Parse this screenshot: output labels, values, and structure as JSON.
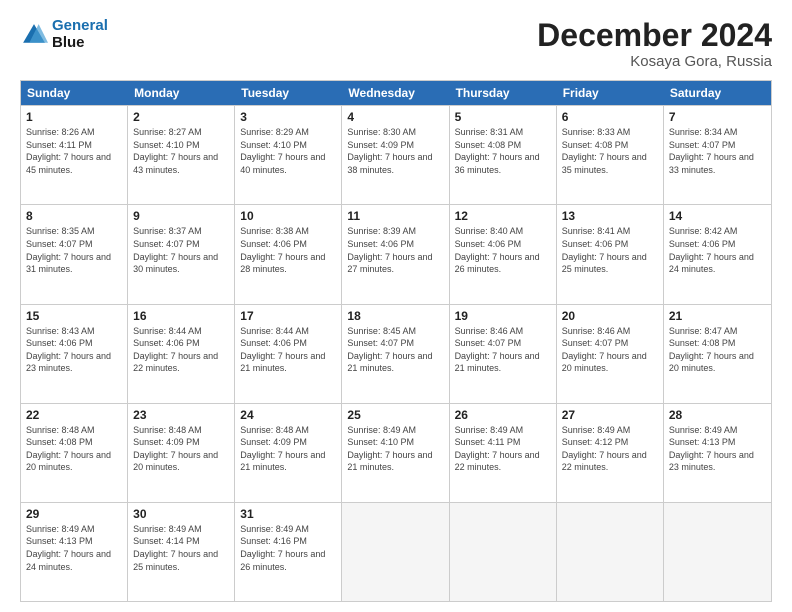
{
  "header": {
    "logo_line1": "General",
    "logo_line2": "Blue",
    "title": "December 2024",
    "subtitle": "Kosaya Gora, Russia"
  },
  "days_of_week": [
    "Sunday",
    "Monday",
    "Tuesday",
    "Wednesday",
    "Thursday",
    "Friday",
    "Saturday"
  ],
  "weeks": [
    [
      {
        "day": 1,
        "sunrise": "Sunrise: 8:26 AM",
        "sunset": "Sunset: 4:11 PM",
        "daylight": "Daylight: 7 hours and 45 minutes."
      },
      {
        "day": 2,
        "sunrise": "Sunrise: 8:27 AM",
        "sunset": "Sunset: 4:10 PM",
        "daylight": "Daylight: 7 hours and 43 minutes."
      },
      {
        "day": 3,
        "sunrise": "Sunrise: 8:29 AM",
        "sunset": "Sunset: 4:10 PM",
        "daylight": "Daylight: 7 hours and 40 minutes."
      },
      {
        "day": 4,
        "sunrise": "Sunrise: 8:30 AM",
        "sunset": "Sunset: 4:09 PM",
        "daylight": "Daylight: 7 hours and 38 minutes."
      },
      {
        "day": 5,
        "sunrise": "Sunrise: 8:31 AM",
        "sunset": "Sunset: 4:08 PM",
        "daylight": "Daylight: 7 hours and 36 minutes."
      },
      {
        "day": 6,
        "sunrise": "Sunrise: 8:33 AM",
        "sunset": "Sunset: 4:08 PM",
        "daylight": "Daylight: 7 hours and 35 minutes."
      },
      {
        "day": 7,
        "sunrise": "Sunrise: 8:34 AM",
        "sunset": "Sunset: 4:07 PM",
        "daylight": "Daylight: 7 hours and 33 minutes."
      }
    ],
    [
      {
        "day": 8,
        "sunrise": "Sunrise: 8:35 AM",
        "sunset": "Sunset: 4:07 PM",
        "daylight": "Daylight: 7 hours and 31 minutes."
      },
      {
        "day": 9,
        "sunrise": "Sunrise: 8:37 AM",
        "sunset": "Sunset: 4:07 PM",
        "daylight": "Daylight: 7 hours and 30 minutes."
      },
      {
        "day": 10,
        "sunrise": "Sunrise: 8:38 AM",
        "sunset": "Sunset: 4:06 PM",
        "daylight": "Daylight: 7 hours and 28 minutes."
      },
      {
        "day": 11,
        "sunrise": "Sunrise: 8:39 AM",
        "sunset": "Sunset: 4:06 PM",
        "daylight": "Daylight: 7 hours and 27 minutes."
      },
      {
        "day": 12,
        "sunrise": "Sunrise: 8:40 AM",
        "sunset": "Sunset: 4:06 PM",
        "daylight": "Daylight: 7 hours and 26 minutes."
      },
      {
        "day": 13,
        "sunrise": "Sunrise: 8:41 AM",
        "sunset": "Sunset: 4:06 PM",
        "daylight": "Daylight: 7 hours and 25 minutes."
      },
      {
        "day": 14,
        "sunrise": "Sunrise: 8:42 AM",
        "sunset": "Sunset: 4:06 PM",
        "daylight": "Daylight: 7 hours and 24 minutes."
      }
    ],
    [
      {
        "day": 15,
        "sunrise": "Sunrise: 8:43 AM",
        "sunset": "Sunset: 4:06 PM",
        "daylight": "Daylight: 7 hours and 23 minutes."
      },
      {
        "day": 16,
        "sunrise": "Sunrise: 8:44 AM",
        "sunset": "Sunset: 4:06 PM",
        "daylight": "Daylight: 7 hours and 22 minutes."
      },
      {
        "day": 17,
        "sunrise": "Sunrise: 8:44 AM",
        "sunset": "Sunset: 4:06 PM",
        "daylight": "Daylight: 7 hours and 21 minutes."
      },
      {
        "day": 18,
        "sunrise": "Sunrise: 8:45 AM",
        "sunset": "Sunset: 4:07 PM",
        "daylight": "Daylight: 7 hours and 21 minutes."
      },
      {
        "day": 19,
        "sunrise": "Sunrise: 8:46 AM",
        "sunset": "Sunset: 4:07 PM",
        "daylight": "Daylight: 7 hours and 21 minutes."
      },
      {
        "day": 20,
        "sunrise": "Sunrise: 8:46 AM",
        "sunset": "Sunset: 4:07 PM",
        "daylight": "Daylight: 7 hours and 20 minutes."
      },
      {
        "day": 21,
        "sunrise": "Sunrise: 8:47 AM",
        "sunset": "Sunset: 4:08 PM",
        "daylight": "Daylight: 7 hours and 20 minutes."
      }
    ],
    [
      {
        "day": 22,
        "sunrise": "Sunrise: 8:48 AM",
        "sunset": "Sunset: 4:08 PM",
        "daylight": "Daylight: 7 hours and 20 minutes."
      },
      {
        "day": 23,
        "sunrise": "Sunrise: 8:48 AM",
        "sunset": "Sunset: 4:09 PM",
        "daylight": "Daylight: 7 hours and 20 minutes."
      },
      {
        "day": 24,
        "sunrise": "Sunrise: 8:48 AM",
        "sunset": "Sunset: 4:09 PM",
        "daylight": "Daylight: 7 hours and 21 minutes."
      },
      {
        "day": 25,
        "sunrise": "Sunrise: 8:49 AM",
        "sunset": "Sunset: 4:10 PM",
        "daylight": "Daylight: 7 hours and 21 minutes."
      },
      {
        "day": 26,
        "sunrise": "Sunrise: 8:49 AM",
        "sunset": "Sunset: 4:11 PM",
        "daylight": "Daylight: 7 hours and 22 minutes."
      },
      {
        "day": 27,
        "sunrise": "Sunrise: 8:49 AM",
        "sunset": "Sunset: 4:12 PM",
        "daylight": "Daylight: 7 hours and 22 minutes."
      },
      {
        "day": 28,
        "sunrise": "Sunrise: 8:49 AM",
        "sunset": "Sunset: 4:13 PM",
        "daylight": "Daylight: 7 hours and 23 minutes."
      }
    ],
    [
      {
        "day": 29,
        "sunrise": "Sunrise: 8:49 AM",
        "sunset": "Sunset: 4:13 PM",
        "daylight": "Daylight: 7 hours and 24 minutes."
      },
      {
        "day": 30,
        "sunrise": "Sunrise: 8:49 AM",
        "sunset": "Sunset: 4:14 PM",
        "daylight": "Daylight: 7 hours and 25 minutes."
      },
      {
        "day": 31,
        "sunrise": "Sunrise: 8:49 AM",
        "sunset": "Sunset: 4:16 PM",
        "daylight": "Daylight: 7 hours and 26 minutes."
      },
      null,
      null,
      null,
      null
    ]
  ]
}
